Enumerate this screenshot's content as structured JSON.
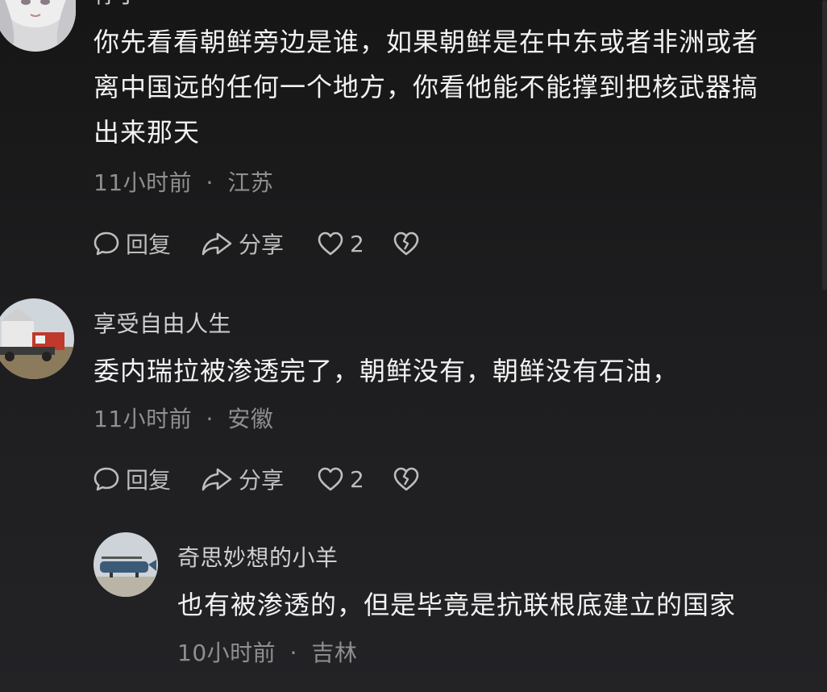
{
  "comments": [
    {
      "username": "柠子",
      "text_lines": [
        "你先看看朝鲜旁边是谁，如果朝鲜是在中东或者非洲或者",
        "离中国远的任何一个地方，你看他能不能撑到把核武器搞",
        "出来那天"
      ],
      "time": "11小时前",
      "location": "江苏",
      "reply_label": "回复",
      "share_label": "分享",
      "likes": "2"
    },
    {
      "username": "享受自由人生",
      "text_lines": [
        "委内瑞拉被渗透完了，朝鲜没有，朝鲜没有石油，"
      ],
      "time": "11小时前",
      "location": "安徽",
      "reply_label": "回复",
      "share_label": "分享",
      "likes": "2"
    },
    {
      "username": "奇思妙想的小羊",
      "text_lines": [
        "也有被渗透的，但是毕竟是抗联根底建立的国家"
      ],
      "time": "10小时前",
      "location": "吉林"
    }
  ],
  "meta_separator": "·",
  "icons": {
    "reply": "speech-bubble-icon",
    "share": "share-arrow-icon",
    "like": "heart-icon",
    "dislike": "broken-heart-icon"
  },
  "colors": {
    "background": "#1b1b1d",
    "body_text": "#f2f2f2",
    "username": "#cfcfcf",
    "meta": "#8f8f8f",
    "action": "#bdbdbd"
  }
}
